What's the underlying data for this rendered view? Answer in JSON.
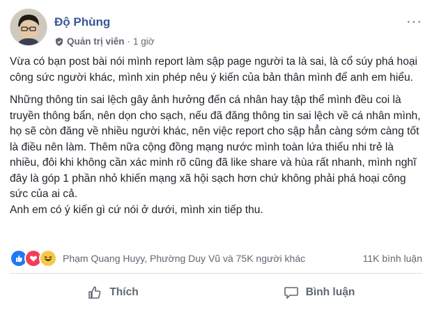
{
  "post": {
    "author": "Độ Phùng",
    "role": "Quản trị viên",
    "separator": "·",
    "time": "1 giờ",
    "more_label": "···",
    "paragraphs": [
      "Vừa có bạn post bài nói mình report làm sập page người ta là sai, là cổ súy phá hoại công sức người khác, mình xin phép nêu ý kiến của bản thân mình để anh em hiểu.",
      "Những thông tin sai lệch gây ảnh hưởng đến cá nhân hay tập thể mình đều coi là truyền thông bẩn, nên dọn cho sạch, nếu đã đăng thông tin sai lệch về cá nhân mình, họ sẽ còn đăng về nhiều người khác, nên việc report cho sập hẳn càng sớm càng tốt là điều nên làm. Thêm nữa cộng đồng mạng nước mình toàn lứa thiếu nhi trẻ là nhiều, đôi khi không cần xác minh rõ cũng đã like share và hùa rất nhanh, mình nghĩ đây là góp 1 phần nhỏ khiến mạng xã hội sạch hơn chứ không phải phá hoại công sức của ai cả.",
      "Anh em có ý kiến gì cứ nói ở dưới, mình xin tiếp thu."
    ]
  },
  "reactions": {
    "names": "Phạm Quang Huyy, Phường Duy Vũ và 75K người khác",
    "comments": "11K bình luận",
    "icons": [
      "like-reaction",
      "love-reaction",
      "haha-reaction"
    ],
    "colors": {
      "like": "#2078f4",
      "love": "#f33e58",
      "haha": "#f7c845"
    }
  },
  "actions": {
    "like_label": "Thích",
    "comment_label": "Bình luận"
  },
  "colors": {
    "author": "#385898",
    "meta": "#616770",
    "divider": "#dadde1"
  }
}
